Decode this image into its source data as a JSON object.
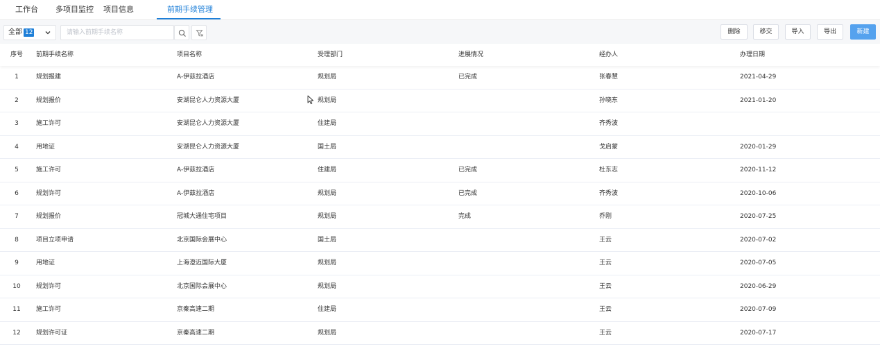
{
  "tabs": [
    {
      "label": "工作台",
      "active": false
    },
    {
      "label": "多项目监控",
      "active": false
    },
    {
      "label": "项目信息",
      "active": false
    },
    {
      "label": "前期手续管理",
      "active": true
    }
  ],
  "toolbar": {
    "filter": {
      "label": "全部",
      "count": "12"
    },
    "search": {
      "placeholder": "请输入前期手续名称",
      "value": ""
    },
    "buttons": {
      "delete": "删除",
      "transfer": "移交",
      "import": "导入",
      "export": "导出",
      "create": "新建"
    }
  },
  "colors": {
    "accent": "#1e7fd8",
    "primary_button": "#55a2ee",
    "toolbar_bg": "#f6f7f9"
  },
  "table": {
    "columns": [
      "序号",
      "前期手续名称",
      "项目名称",
      "受理部门",
      "进展情况",
      "经办人",
      "办理日期"
    ],
    "rows": [
      [
        "1",
        "规划报建",
        "A-伊兹拉酒店",
        "规划局",
        "已完成",
        "张春慧",
        "2021-04-29"
      ],
      [
        "2",
        "规划报价",
        "安湖昆仑人力资源大厦",
        "规划局",
        "",
        "孙晓东",
        "2021-01-20"
      ],
      [
        "3",
        "施工许可",
        "安湖昆仑人力资源大厦",
        "住建局",
        "",
        "齐秀波",
        ""
      ],
      [
        "4",
        "用地证",
        "安湖昆仑人力资源大厦",
        "国土局",
        "",
        "戈启蒙",
        "2020-01-29"
      ],
      [
        "5",
        "施工许可",
        "A-伊兹拉酒店",
        "住建局",
        "已完成",
        "杜东志",
        "2020-11-12"
      ],
      [
        "6",
        "规划许可",
        "A-伊兹拉酒店",
        "规划局",
        "已完成",
        "齐秀波",
        "2020-10-06"
      ],
      [
        "7",
        "规划报价",
        "冠城大通住宅项目",
        "规划局",
        "完成",
        "乔刚",
        "2020-07-25"
      ],
      [
        "8",
        "项目立项申请",
        "北京国际会展中心",
        "国土局",
        "",
        "王云",
        "2020-07-02"
      ],
      [
        "9",
        "用地证",
        "上海澄迈国际大厦",
        "规划局",
        "",
        "王云",
        "2020-07-05"
      ],
      [
        "10",
        "规划许可",
        "北京国际会展中心",
        "规划局",
        "",
        "王云",
        "2020-06-29"
      ],
      [
        "11",
        "施工许可",
        "京秦高速二期",
        "住建局",
        "",
        "王云",
        "2020-07-09"
      ],
      [
        "12",
        "规划许可证",
        "京秦高速二期",
        "规划局",
        "",
        "王云",
        "2020-07-17"
      ]
    ]
  }
}
